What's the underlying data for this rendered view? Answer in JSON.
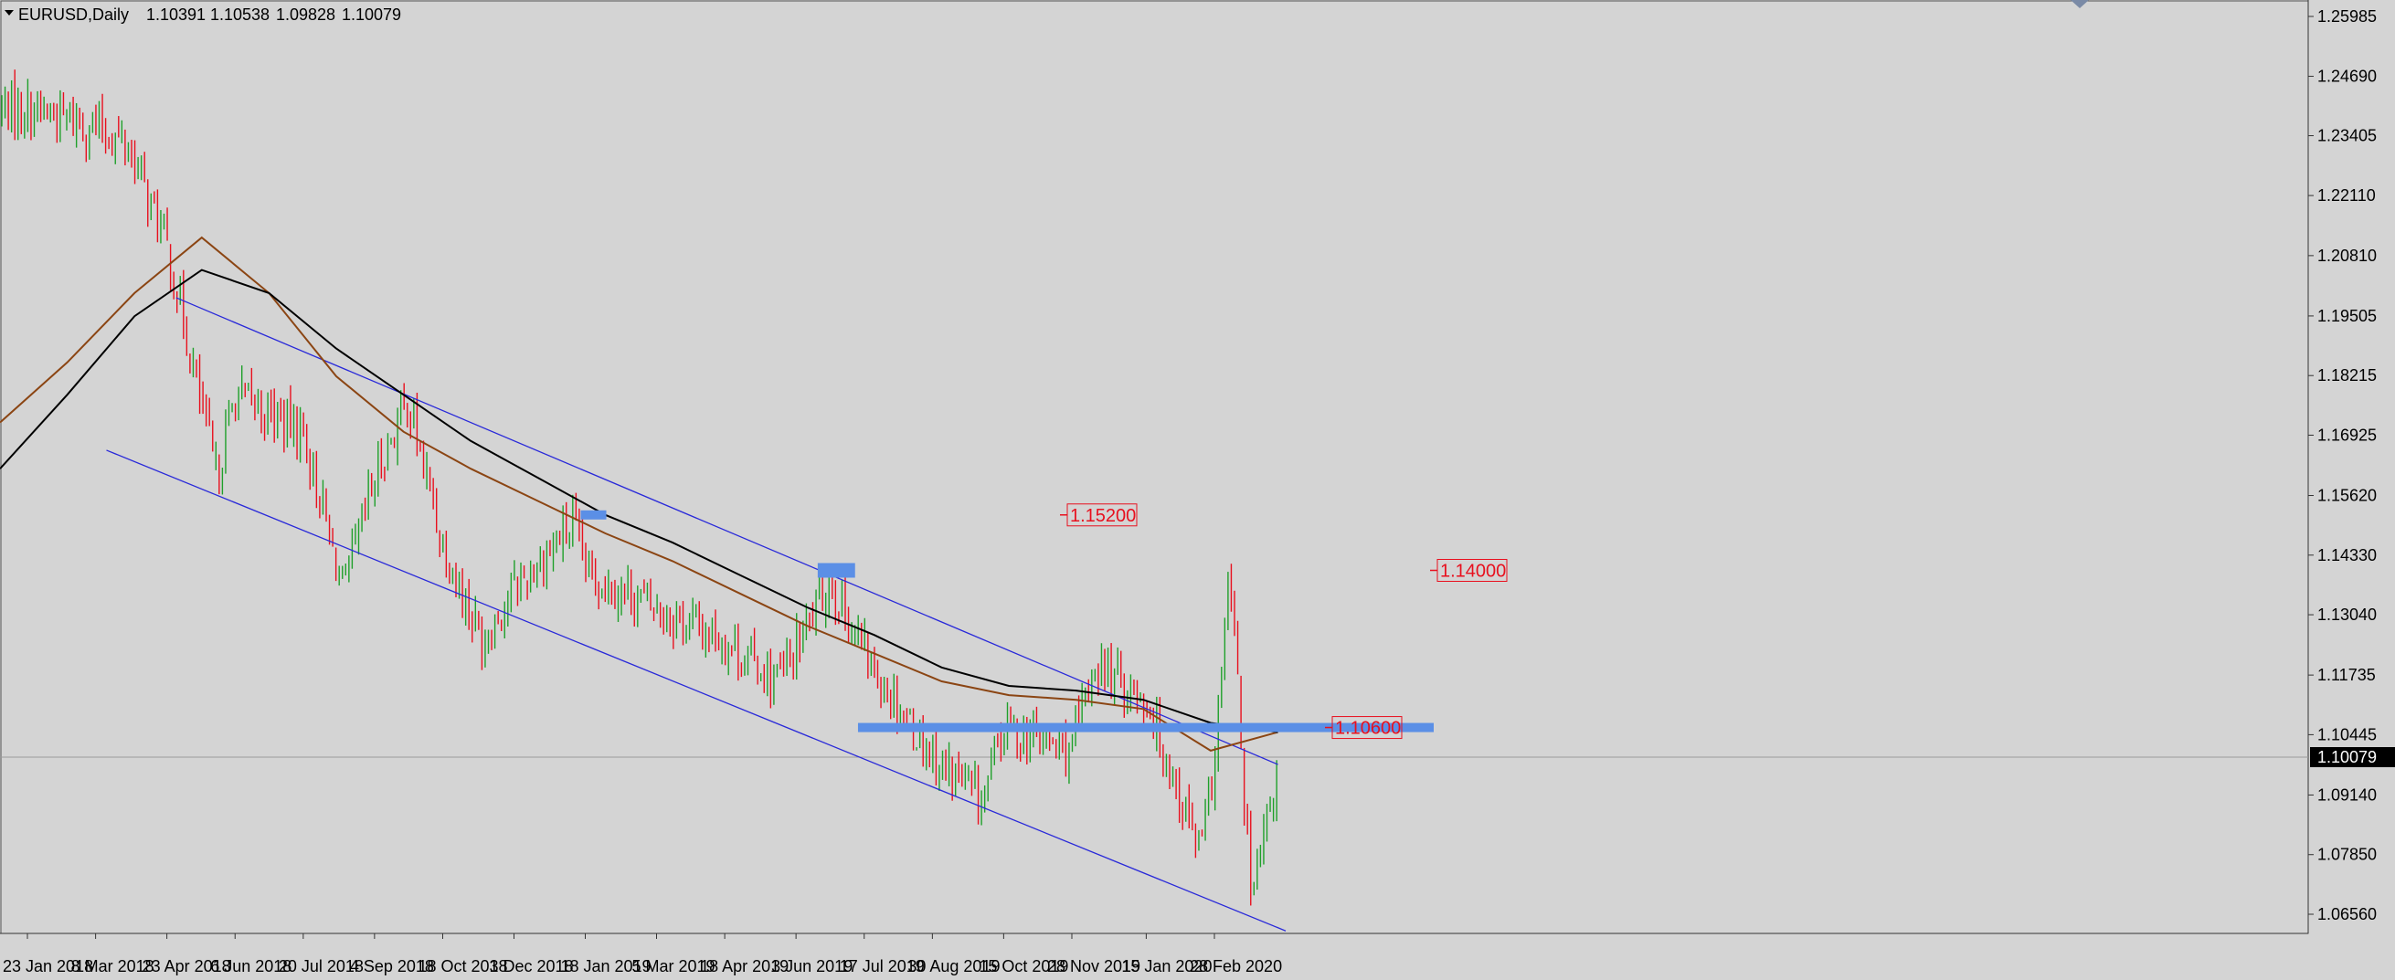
{
  "header": {
    "symbol": "EURUSD,Daily",
    "open": "1.10391",
    "high": "1.10538",
    "low": "1.09828",
    "close": "1.10079"
  },
  "colors": {
    "background": "#d4d4d4",
    "bull_candle": "#1fa02a",
    "bear_candle": "#e8101e",
    "ma_fast": "#8b4513",
    "ma_slow": "#000000",
    "channel": "#2929d9",
    "zone": "#5b8fe6",
    "level_label": "#e8101e",
    "current_price_bg": "#000000"
  },
  "chart_data": {
    "type": "candlestick",
    "title": "EURUSD,Daily",
    "ylim": [
      1.058,
      1.262
    ],
    "y_ticks": [
      "1.25985",
      "1.24690",
      "1.23405",
      "1.22110",
      "1.20810",
      "1.19505",
      "1.18215",
      "1.16925",
      "1.15620",
      "1.14330",
      "1.13040",
      "1.11735",
      "1.10445",
      "1.09140",
      "1.07850",
      "1.06560"
    ],
    "x_ticks": [
      "23 Jan 2018",
      "8 Mar 2018",
      "23 Apr 2018",
      "6 Jun 2018",
      "20 Jul 2018",
      "4 Sep 2018",
      "18 Oct 2018",
      "3 Dec 2018",
      "18 Jan 2019",
      "5 Mar 2019",
      "18 Apr 2019",
      "3 Jun 2019",
      "17 Jul 2019",
      "30 Aug 2019",
      "15 Oct 2019",
      "28 Nov 2019",
      "15 Jan 2020",
      "28 Feb 2020"
    ],
    "current_price": "1.10079",
    "close_path": [
      [
        "23 Jan 2018",
        1.24
      ],
      [
        "8 Mar 2018",
        1.236
      ],
      [
        "29 Mar 2018",
        1.232
      ],
      [
        "23 Apr 2018",
        1.21
      ],
      [
        "3 May 2018",
        1.195
      ],
      [
        "25 May 2018",
        1.16
      ],
      [
        "6 Jun 2018",
        1.178
      ],
      [
        "20 Jul 2018",
        1.17
      ],
      [
        "15 Aug 2018",
        1.135
      ],
      [
        "4 Sep 2018",
        1.16
      ],
      [
        "25 Sep 2018",
        1.177
      ],
      [
        "18 Oct 2018",
        1.146
      ],
      [
        "12 Nov 2018",
        1.125
      ],
      [
        "3 Dec 2018",
        1.136
      ],
      [
        "10 Jan 2019",
        1.15
      ],
      [
        "18 Jan 2019",
        1.14
      ],
      [
        "5 Mar 2019",
        1.132
      ],
      [
        "18 Apr 2019",
        1.125
      ],
      [
        "22 May 2019",
        1.116
      ],
      [
        "3 Jun 2019",
        1.123
      ],
      [
        "25 Jun 2019",
        1.138
      ],
      [
        "17 Jul 2019",
        1.122
      ],
      [
        "30 Aug 2019",
        1.1
      ],
      [
        "1 Oct 2019",
        1.09
      ],
      [
        "15 Oct 2019",
        1.106
      ],
      [
        "28 Nov 2019",
        1.101
      ],
      [
        "13 Dec 2019",
        1.12
      ],
      [
        "15 Jan 2020",
        1.112
      ],
      [
        "19 Feb 2020",
        1.079
      ],
      [
        "28 Feb 2020",
        1.098
      ],
      [
        "9 Mar 2020",
        1.14
      ],
      [
        "23 Mar 2020",
        1.067
      ],
      [
        "10 Apr 2020",
        1.1
      ]
    ],
    "ma_fast_path": [
      1.172,
      1.185,
      1.2,
      1.212,
      1.2,
      1.182,
      1.17,
      1.162,
      1.155,
      1.148,
      1.142,
      1.135,
      1.128,
      1.122,
      1.116,
      1.113,
      1.112,
      1.11,
      1.101,
      1.105
    ],
    "ma_slow_path": [
      1.162,
      1.178,
      1.195,
      1.205,
      1.2,
      1.188,
      1.178,
      1.168,
      1.16,
      1.152,
      1.146,
      1.139,
      1.132,
      1.126,
      1.119,
      1.115,
      1.114,
      1.112,
      1.107,
      1.105
    ],
    "channel_upper": [
      [
        "29 Apr 2018",
        1.199
      ],
      [
        "9 Apr 2020",
        1.098
      ]
    ],
    "channel_lower": [
      [
        "15 Mar 2018",
        1.166
      ],
      [
        "14 Apr 2020",
        1.062
      ]
    ],
    "zones": [
      {
        "label": "1.15200",
        "price": 1.152
      },
      {
        "label": "1.14000",
        "price": 1.14
      },
      {
        "label": "1.10600",
        "price": 1.106
      }
    ]
  }
}
